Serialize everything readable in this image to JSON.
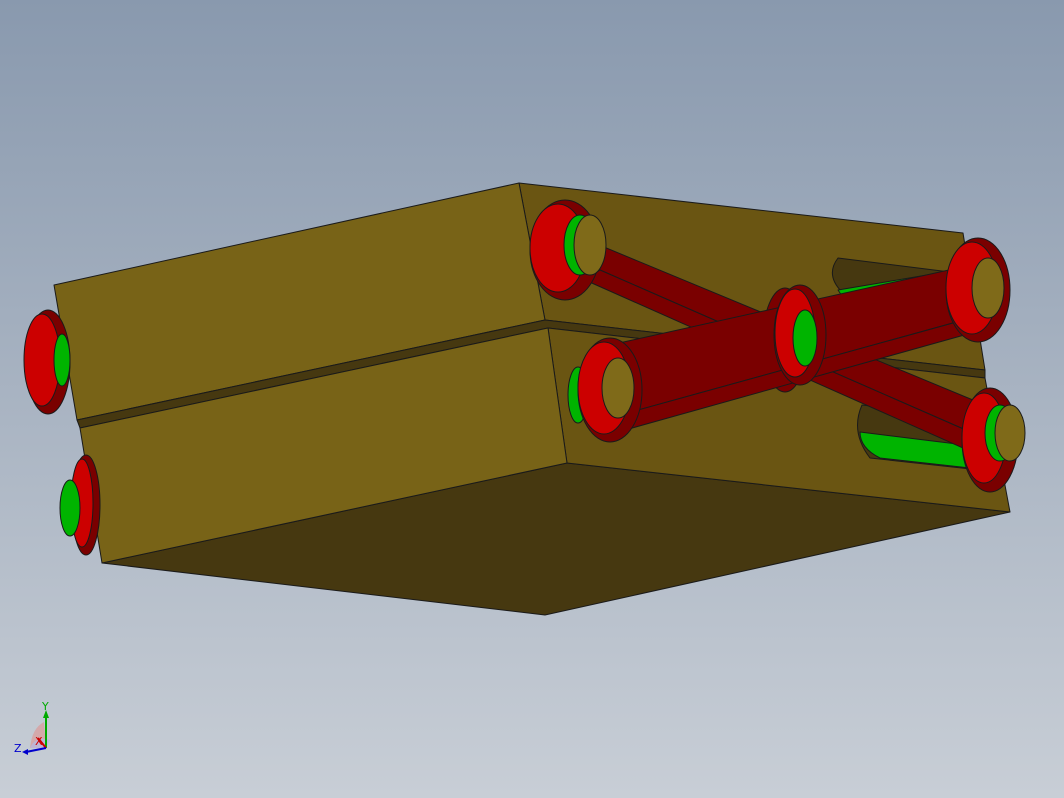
{
  "viewport": {
    "background_top": "#8999ae",
    "background_bottom": "#c8ced6"
  },
  "model": {
    "block_color": "#786317",
    "block_side_color": "#6a5512",
    "block_bottom_color": "#463810",
    "link_color": "#7a0000",
    "link_highlight": "#cc0000",
    "pin_color": "#00b400",
    "pin_face_color": "#7f6a19"
  },
  "triad": {
    "x_label": "X",
    "y_label": "Y",
    "z_label": "Z",
    "x_color": "#cc0000",
    "y_color": "#00aa00",
    "z_color": "#0000cc"
  }
}
